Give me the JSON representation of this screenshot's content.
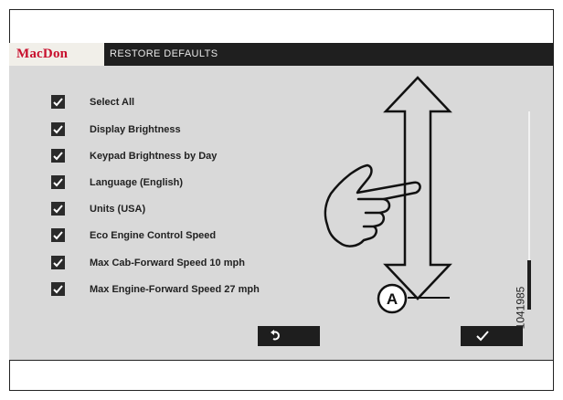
{
  "header": {
    "logo": "MacDon",
    "title": "RESTORE DEFAULTS"
  },
  "items": [
    {
      "label": "Select All",
      "checked": true
    },
    {
      "label": "Display Brightness",
      "checked": true
    },
    {
      "label": "Keypad Brightness by Day",
      "checked": true
    },
    {
      "label": "Language (English)",
      "checked": true
    },
    {
      "label": "Units (USA)",
      "checked": true
    },
    {
      "label": "Eco Engine Control Speed",
      "checked": true
    },
    {
      "label": "Max Cab-Forward Speed 10 mph",
      "checked": true
    },
    {
      "label": "Max Engine-Forward Speed 27 mph",
      "checked": true
    }
  ],
  "buttons": {
    "back_icon": "undo-arrow-icon",
    "confirm_icon": "checkmark-icon"
  },
  "callout": {
    "letter": "A"
  },
  "figure_number": "1041985",
  "colors": {
    "brand": "#c8102e",
    "header_bg": "#1f1f1f",
    "screen_bg": "#d9d9d9"
  }
}
